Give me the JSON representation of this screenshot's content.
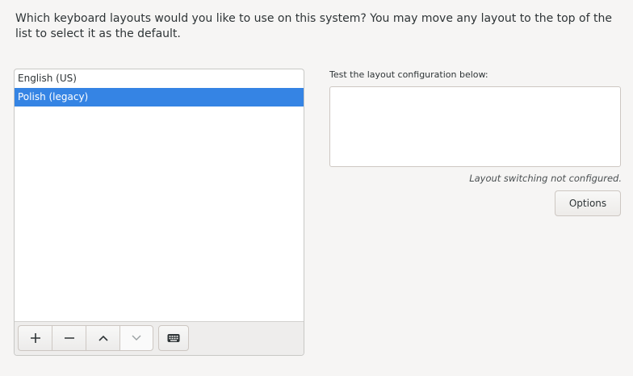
{
  "intro_text": "Which keyboard layouts would you like to use on this system?  You may move any layout to the top of the list to select it as the default.",
  "layouts": [
    {
      "label": "English (US)",
      "selected": false
    },
    {
      "label": "Polish (legacy)",
      "selected": true
    }
  ],
  "toolbar": {
    "add_icon": "plus-icon",
    "remove_icon": "minus-icon",
    "move_up_icon": "chevron-up-icon",
    "move_down_icon": "chevron-down-icon",
    "preview_icon": "keyboard-icon"
  },
  "test_area": {
    "label": "Test the layout configuration below:",
    "value": ""
  },
  "status_text": "Layout switching not configured.",
  "options_label": "Options",
  "colors": {
    "accent": "#3584e4",
    "background": "#f6f5f4"
  }
}
